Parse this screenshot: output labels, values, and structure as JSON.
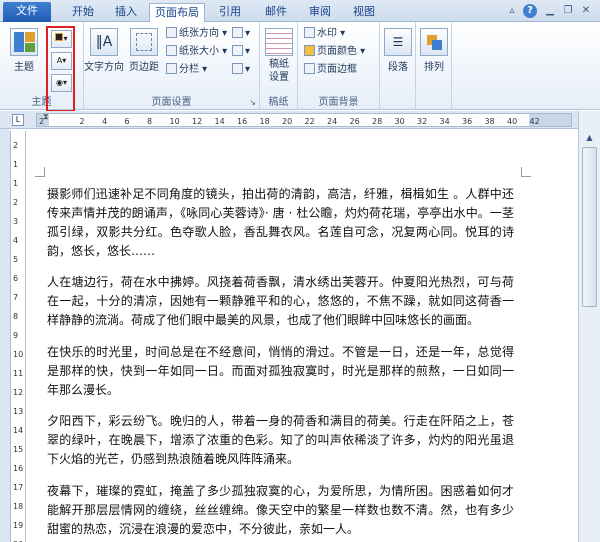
{
  "tabs": [
    {
      "label": "文件",
      "name": "tab-file"
    },
    {
      "label": "开始",
      "name": "tab-home"
    },
    {
      "label": "插入",
      "name": "tab-insert"
    },
    {
      "label": "页面布局",
      "name": "tab-page-layout"
    },
    {
      "label": "引用",
      "name": "tab-references"
    },
    {
      "label": "邮件",
      "name": "tab-mailings"
    },
    {
      "label": "审阅",
      "name": "tab-review"
    },
    {
      "label": "视图",
      "name": "tab-view"
    }
  ],
  "ribbon": {
    "theme": {
      "themes_label": "主题",
      "group_label": "主题"
    },
    "page_setup": {
      "text_direction": "文字方向",
      "margins": "页边距",
      "orientation": "纸张方向",
      "size": "纸张大小",
      "columns": "分栏",
      "group_label": "页面设置"
    },
    "draft": {
      "draft_setup": "稿纸\n设置",
      "group_label": "稿纸"
    },
    "page_background": {
      "watermark": "水印",
      "page_color": "页面颜色",
      "page_borders": "页面边框",
      "group_label": "页面背景"
    },
    "paragraph": "段落",
    "arrange": "排列"
  },
  "ruler_h": [
    "2",
    "2",
    "4",
    "6",
    "8",
    "10",
    "12",
    "14",
    "16",
    "18",
    "20",
    "22",
    "24",
    "26",
    "28",
    "30",
    "32",
    "34",
    "36",
    "38",
    "40",
    "42"
  ],
  "ruler_v": [
    "2",
    "1",
    "1",
    "2",
    "3",
    "4",
    "5",
    "6",
    "7",
    "8",
    "9",
    "10",
    "11",
    "12",
    "13",
    "14",
    "15",
    "16",
    "17",
    "18",
    "19",
    "20"
  ],
  "document": {
    "paragraphs": [
      "摄影师们迅速补足不同角度的镜头，拍出荷的清韵，高洁，纤雅，楫楫如生 。人群中还传来声情并茂的朗诵声，《咏同心芙蓉诗》· 唐 · 杜公瞻，灼灼荷花瑞，亭亭出水中。一茎孤引绿，双影共分红。色夺歌人脸，香乱舞衣风。名莲自可念，况复两心同。悦耳的诗韵，悠长，悠长……",
      "人在塘边行，荷在水中拂婷。风挠着荷香飘，清水绣出芙蓉开。仲夏阳光热烈，可与荷在一起，十分的清凉，因她有一颗静雅平和的心，悠悠的，不焦不躁，就如同这荷香一样静静的流淌。荷成了他们眼中最美的风景，也成了他们眼眸中回味悠长的画面。",
      "在快乐的时光里，时间总是在不经意间，悄悄的滑过。不管是一日，还是一年，总觉得是那样的快，快到一年如同一日。而面对孤独寂寞时，时光是那样的煎熬，一日如同一年那么漫长。",
      "夕阳西下，彩云纷飞。晚归的人，带着一身的荷香和满目的荷美。行走在阡陌之上，苍翠的绿叶，在晚晨下，增添了浓重的色彩。知了的叫声依稀淡了许多，灼灼的阳光虽退下火焰的光芒，仍感到热浪随着晚风阵阵涌来。",
      "夜幕下，璀璨的霓虹，掩盖了多少孤独寂寞的心，为爱所思，为情所困。困惑着如何才能解开那层层情网的缠绕，丝丝缠绵。像天空中的繁星一样数也数不清。然，也有多少甜蜜的热恋，沉浸在浪漫的爱恋中，不分彼此，亲如一人。"
    ]
  },
  "colors": {
    "accent": "#1f5db5",
    "highlight": "#e02020",
    "ribbon_bg": "#e6eef8"
  }
}
